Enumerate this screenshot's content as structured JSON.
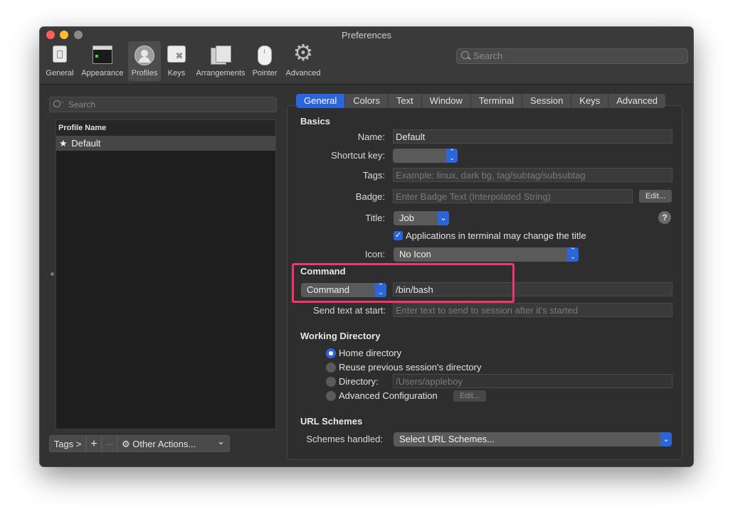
{
  "window": {
    "title": "Preferences"
  },
  "toolbar": {
    "items": [
      {
        "label": "General",
        "icon": "general-icon"
      },
      {
        "label": "Appearance",
        "icon": "appearance-icon"
      },
      {
        "label": "Profiles",
        "icon": "profiles-icon",
        "active": true
      },
      {
        "label": "Keys",
        "icon": "keys-icon",
        "glyph": "⌘"
      },
      {
        "label": "Arrangements",
        "icon": "arrangements-icon"
      },
      {
        "label": "Pointer",
        "icon": "pointer-icon"
      },
      {
        "label": "Advanced",
        "icon": "gear-icon",
        "glyph": "⚙"
      }
    ],
    "search_placeholder": "Search"
  },
  "sidebar": {
    "search_placeholder": "Search",
    "column_header": "Profile Name",
    "profiles": [
      {
        "name": "Default",
        "star": "★"
      }
    ],
    "tags_button": "Tags >",
    "add_button": "+",
    "remove_button": "—",
    "other_actions": "Other Actions...",
    "gear_glyph": "⚙",
    "chevron": "⌄"
  },
  "tabs": [
    "General",
    "Colors",
    "Text",
    "Window",
    "Terminal",
    "Session",
    "Keys",
    "Advanced"
  ],
  "basics": {
    "title": "Basics",
    "name_label": "Name:",
    "name_value": "Default",
    "shortcut_label": "Shortcut key:",
    "shortcut_value": "",
    "tags_label": "Tags:",
    "tags_placeholder": "Example: linux, dark bg, tag/subtag/subsubtag",
    "badge_label": "Badge:",
    "badge_placeholder": "Enter Badge Text (Interpolated String)",
    "badge_edit": "Edit...",
    "title_label": "Title:",
    "title_value": "Job",
    "help": "?",
    "title_checkbox": "Applications in terminal may change the title",
    "title_checkbox_checked": true,
    "icon_label": "Icon:",
    "icon_value": "No Icon"
  },
  "command": {
    "title": "Command",
    "type_value": "Command",
    "command_value": "/bin/bash",
    "send_text_label": "Send text at start:",
    "send_text_placeholder": "Enter text to send to session after it's started"
  },
  "working_directory": {
    "title": "Working Directory",
    "options": [
      {
        "label": "Home directory",
        "selected": true
      },
      {
        "label": "Reuse previous session's directory",
        "selected": false
      },
      {
        "label": "Directory:",
        "selected": false
      },
      {
        "label": "Advanced Configuration",
        "selected": false
      }
    ],
    "directory_value": "/Users/appleboy",
    "advanced_edit": "Edit..."
  },
  "url_schemes": {
    "title": "URL Schemes",
    "label": "Schemes handled:",
    "value": "Select URL Schemes..."
  },
  "colors": {
    "accent": "#2a66d9",
    "highlight": "#f2366a",
    "close": "#ff5f57",
    "minimize": "#febc2e",
    "zoom": "#8a8a8a"
  }
}
